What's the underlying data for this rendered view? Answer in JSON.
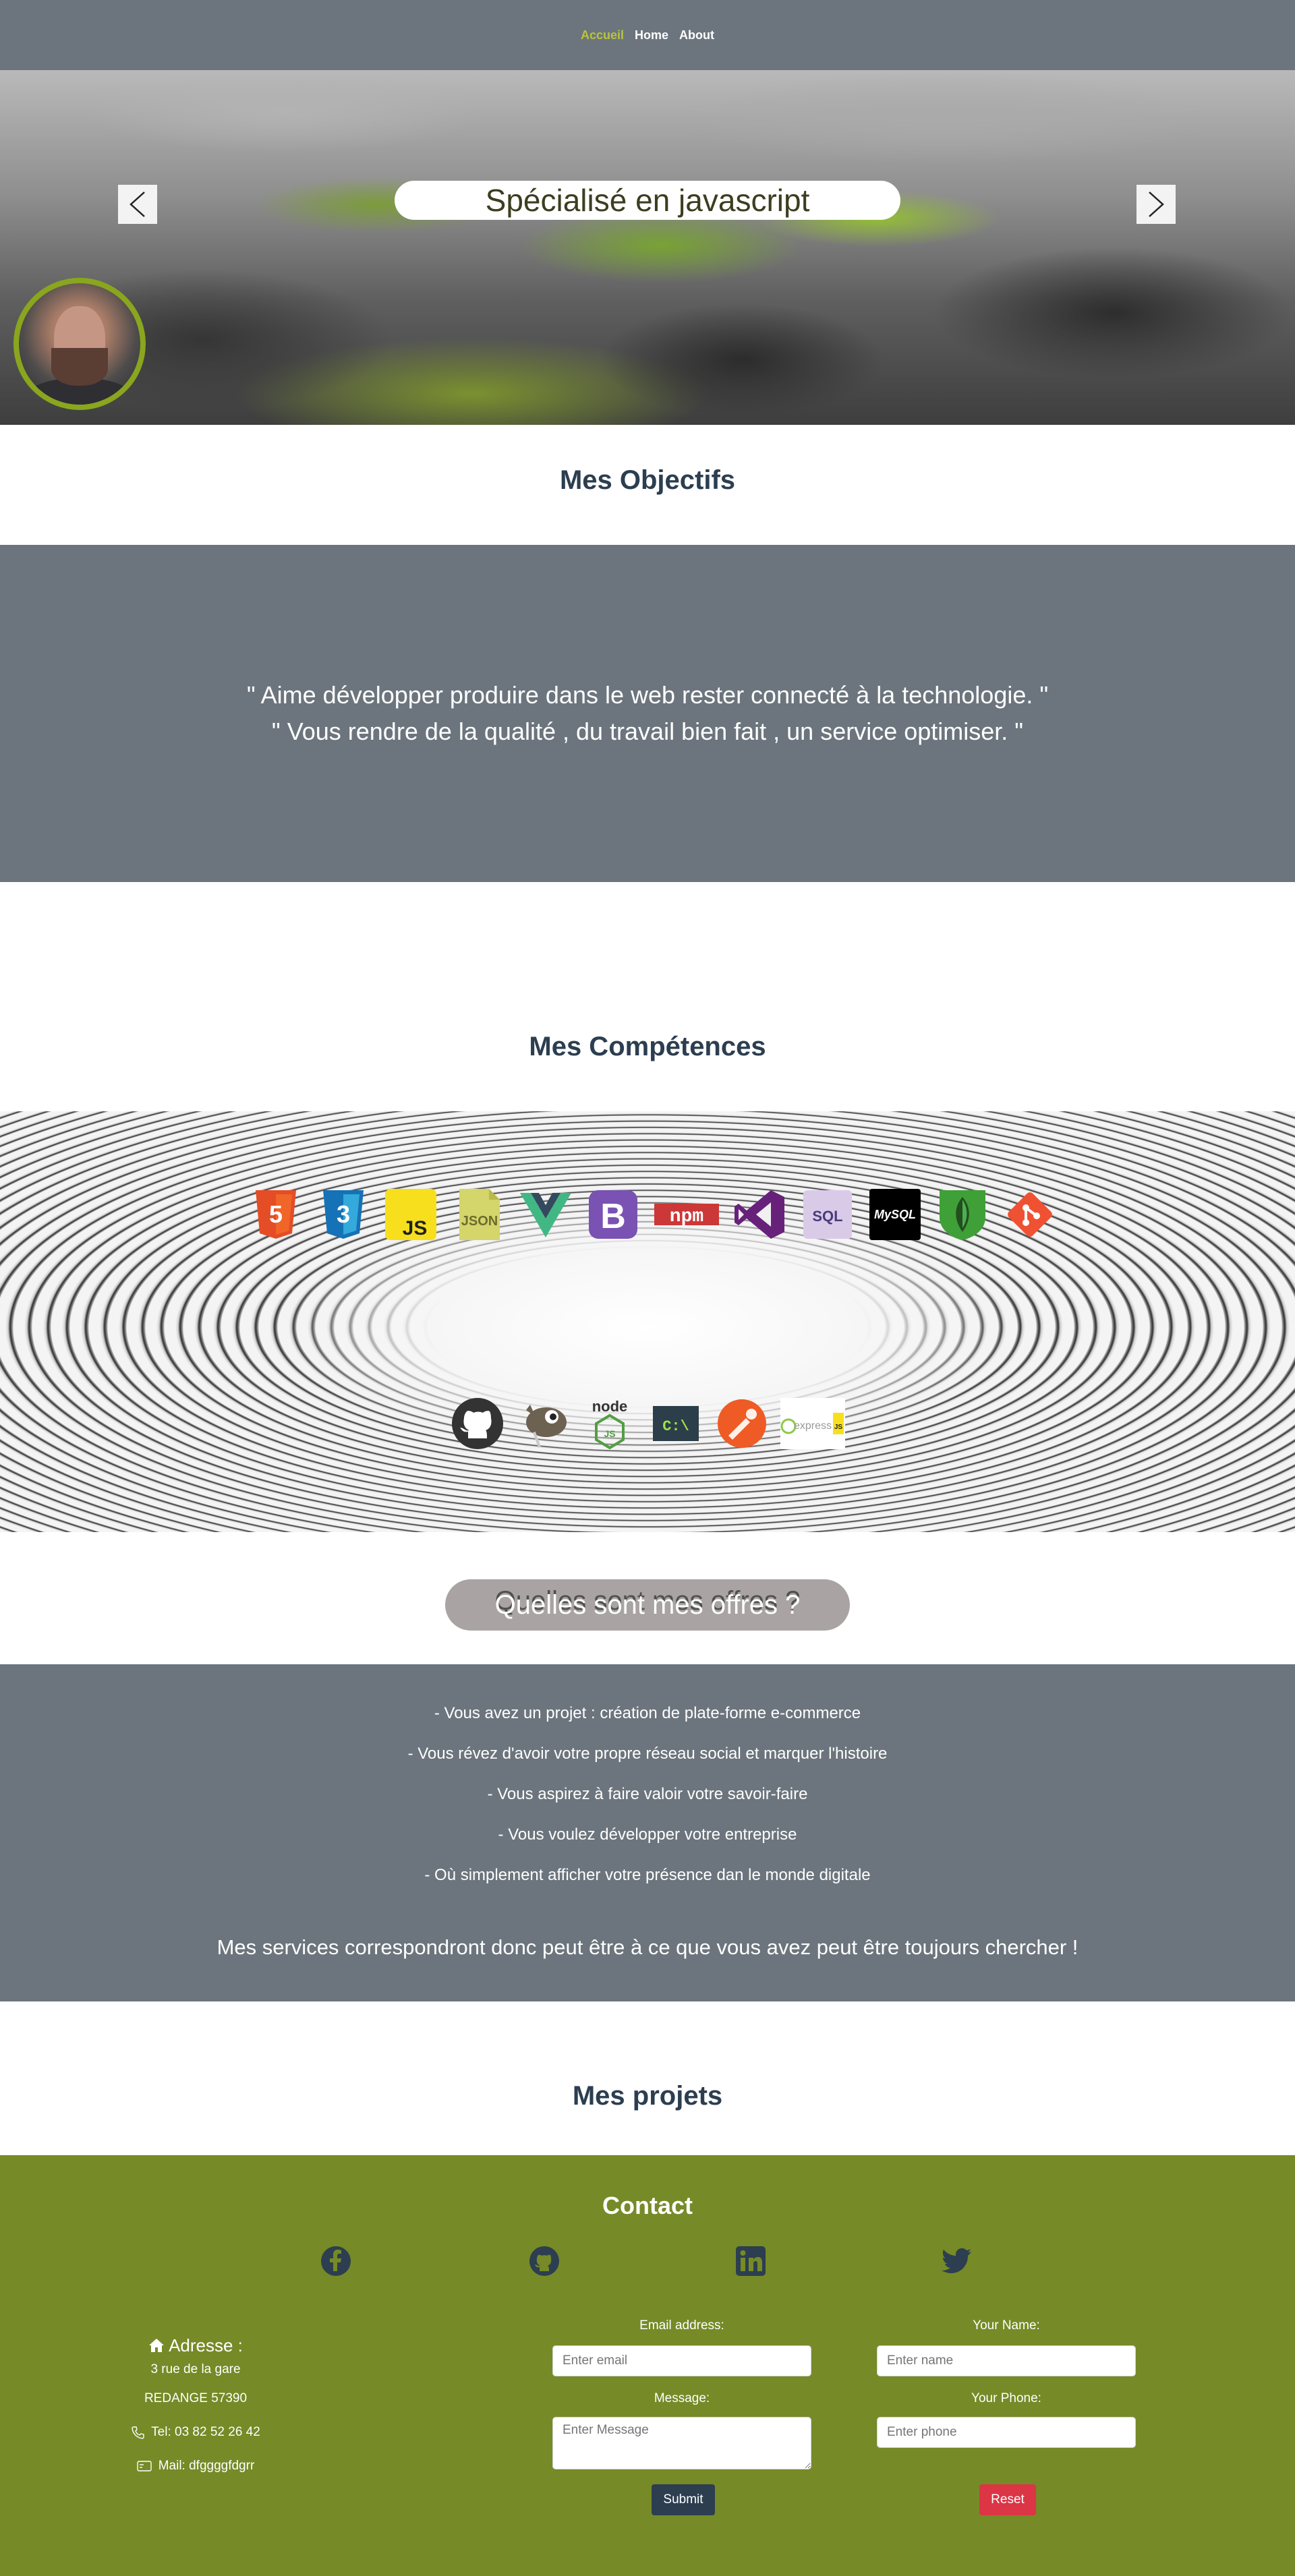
{
  "nav": {
    "items": [
      {
        "label": "Accueil",
        "active": true
      },
      {
        "label": "Home",
        "active": false
      },
      {
        "label": "About",
        "active": false
      }
    ],
    "accent_color": "#b8c43a"
  },
  "hero": {
    "caption": "Spécialisé en javascript",
    "prev_icon": "chevron-left-icon",
    "next_icon": "chevron-right-icon"
  },
  "objectifs": {
    "title": "Mes Objectifs",
    "quotes": [
      "\" Aime développer produire dans le web rester connecté à la technologie. \"",
      "\" Vous rendre de la qualité , du travail bien fait , un service optimiser. \""
    ]
  },
  "competences": {
    "title": "Mes Compétences",
    "row1": [
      "html5-icon",
      "css3-icon",
      "javascript-icon",
      "json-icon",
      "vue-icon",
      "bootstrap-icon",
      "npm-icon",
      "visual-studio-icon",
      "sql-icon",
      "mysql-icon",
      "mongodb-icon",
      "git-icon"
    ],
    "row1_text": {
      "js": "JS",
      "json": "JSON",
      "npm": "npm",
      "sql": "SQL",
      "mysql": "MySQL"
    },
    "row2": [
      "github-icon",
      "gimp-icon",
      "nodejs-icon",
      "terminal-icon",
      "postman-icon",
      "expressjs-icon"
    ],
    "row2_text": {
      "node": "node",
      "terminal": "C:\\",
      "express": "express",
      "expressjs": "JS"
    }
  },
  "offres": {
    "title": "Quelles sont mes offres ?",
    "items": [
      "- Vous avez un projet : création de plate-forme e-commerce",
      "- Vous révez d'avoir votre propre réseau social et marquer l'histoire",
      "- Vous aspirez à faire valoir votre savoir-faire",
      "- Vous voulez développer votre entreprise",
      "- Où simplement afficher votre présence dan le monde digitale"
    ],
    "conclusion": "Mes services correspondront donc peut être à ce que vous avez peut être toujours chercher !"
  },
  "projets": {
    "title": "Mes projets"
  },
  "contact": {
    "title": "Contact",
    "socials": [
      "facebook-icon",
      "github-icon",
      "linkedin-icon",
      "twitter-icon"
    ],
    "address": {
      "heading": "Adresse :",
      "street": "3 rue de la gare",
      "city": "REDANGE 57390",
      "phone": "Tel: 03 82 52 26 42",
      "mail": "Mail: dfggggfdgrr"
    },
    "form": {
      "email_label": "Email address:",
      "email_placeholder": "Enter email",
      "name_label": "Your Name:",
      "name_placeholder": "Enter name",
      "message_label": "Message:",
      "message_placeholder": "Enter Message",
      "phone_label": "Your Phone:",
      "phone_placeholder": "Enter phone",
      "submit_label": "Submit",
      "reset_label": "Reset"
    },
    "background_color": "#768a27"
  }
}
